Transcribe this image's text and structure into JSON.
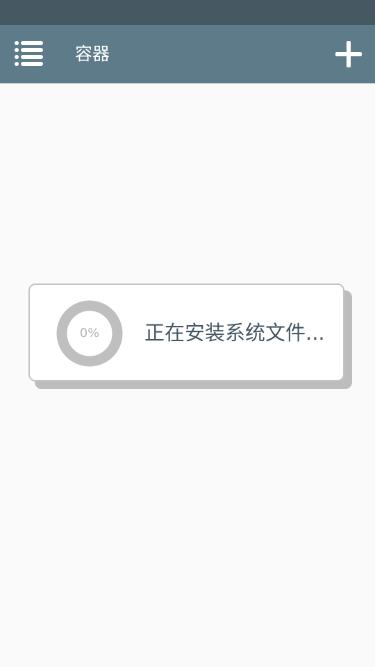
{
  "colors": {
    "status_bar": "#465963",
    "app_bar": "#5e7b89",
    "background": "#fafafa",
    "ring": "#bfbfbf",
    "message_text": "#455660"
  },
  "app_bar": {
    "menu_icon": "list-menu-icon",
    "title": "容器",
    "add_icon": "plus-icon"
  },
  "install_dialog": {
    "progress": 0,
    "progress_label": "0%",
    "message": "正在安装系统文件..."
  }
}
